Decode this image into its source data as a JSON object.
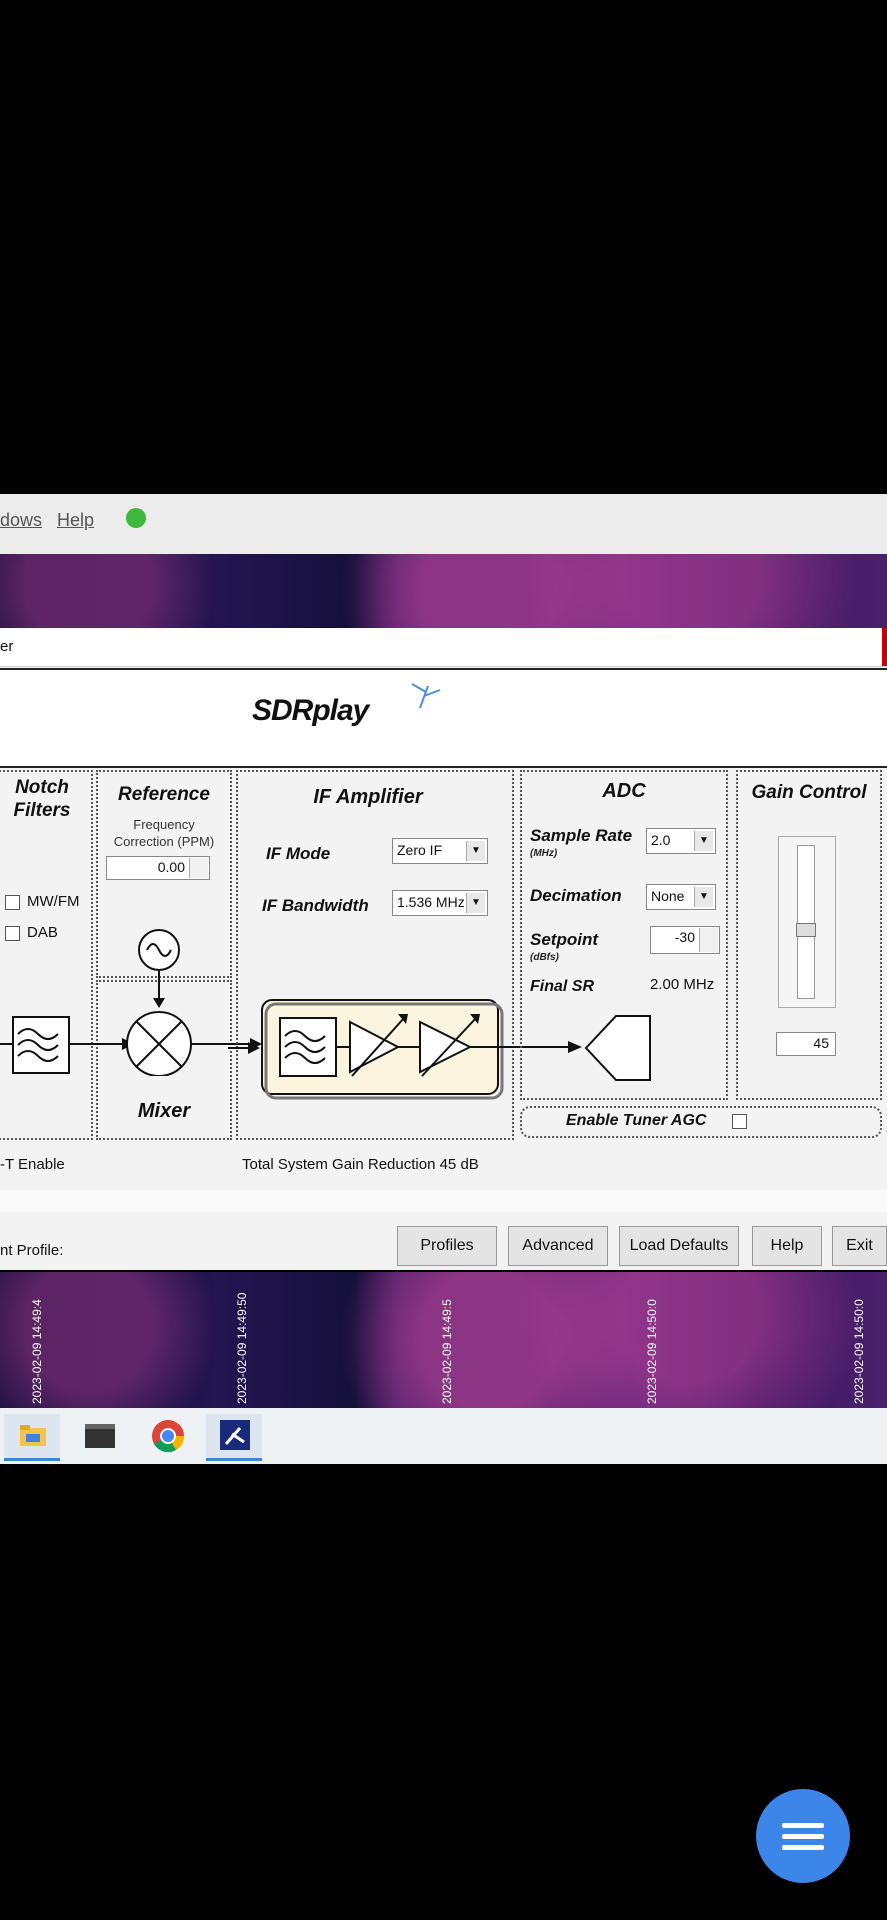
{
  "menubar": {
    "windows_label": "dows",
    "help_label": "Help"
  },
  "dialog": {
    "title_fragment": "er",
    "logo_text": "SDRplay",
    "notch": {
      "title_line1": "Notch",
      "title_line2": "Filters",
      "mwfm_label": "MW/FM",
      "dab_label": "DAB"
    },
    "reference": {
      "title": "Reference",
      "freq_label_line1": "Frequency",
      "freq_label_line2": "Correction (PPM)",
      "ppm_value": "0.00"
    },
    "mixer": {
      "title": "Mixer"
    },
    "if_amp": {
      "title": "IF Amplifier",
      "mode_label": "IF Mode",
      "mode_value": "Zero IF",
      "bw_label": "IF Bandwidth",
      "bw_value": "1.536 MHz"
    },
    "adc": {
      "title": "ADC",
      "sr_label": "Sample Rate",
      "sr_unit": "(MHz)",
      "sr_value": "2.0",
      "dec_label": "Decimation",
      "dec_value": "None",
      "setpoint_label": "Setpoint",
      "setpoint_unit": "(dBfs)",
      "setpoint_value": "-30",
      "final_sr_label": "Final SR",
      "final_sr_value": "2.00 MHz",
      "agc_label": "Enable Tuner AGC"
    },
    "gain": {
      "title": "Gain Control",
      "value": "45",
      "slider_level": 0.45
    },
    "biast_label": "-T Enable",
    "total_gain_text": "Total System Gain Reduction 45 dB",
    "profile_label": "nt Profile:",
    "buttons": {
      "profiles": "Profiles",
      "advanced": "Advanced",
      "load_defaults": "Load Defaults",
      "help": "Help",
      "exit": "Exit"
    }
  },
  "timestamps": [
    "2023-02-09 14:49:4",
    "2023-02-09 14:49:50",
    "2023-02-09 14:49:5",
    "2023-02-09 14:50:0",
    "2023-02-09 14:50:0"
  ],
  "taskbar": {
    "apps": [
      "file-explorer-icon",
      "terminal-icon",
      "chrome-icon",
      "sdr-app-icon"
    ]
  },
  "colors": {
    "fab": "#3b86e8",
    "waterfall_accent": "#5a2475"
  }
}
